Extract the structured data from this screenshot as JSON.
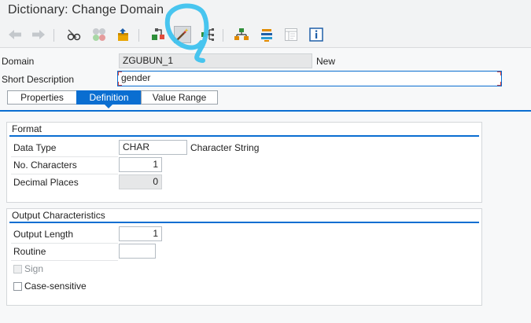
{
  "window": {
    "title": "Dictionary: Change Domain"
  },
  "toolbar": {
    "buttons": [
      {
        "icon": "back-arrow-icon"
      },
      {
        "icon": "forward-arrow-icon"
      },
      {
        "icon": "glasses-display-change-icon"
      },
      {
        "icon": "activate-icon"
      },
      {
        "icon": "transport-object-icon"
      },
      {
        "icon": "where-used-list-icon"
      },
      {
        "icon": "magic-wand-icon"
      },
      {
        "icon": "hierarchy-branch-icon"
      },
      {
        "icon": "object-hierarchy-icon"
      },
      {
        "icon": "stack-display-icon"
      },
      {
        "icon": "documentation-icon"
      },
      {
        "icon": "info-icon"
      }
    ]
  },
  "header": {
    "domain_label": "Domain",
    "domain_value": "ZGUBUN_1",
    "status": "New",
    "short_desc_label": "Short Description",
    "short_desc_value": "gender"
  },
  "tabs": [
    {
      "label": "Properties",
      "active": false
    },
    {
      "label": "Definition",
      "active": true
    },
    {
      "label": "Value Range",
      "active": false
    }
  ],
  "format": {
    "title": "Format",
    "data_type_label": "Data Type",
    "data_type_value": "CHAR",
    "data_type_desc": "Character String",
    "no_chars_label": "No. Characters",
    "no_chars_value": "1",
    "decimal_label": "Decimal Places",
    "decimal_value": "0"
  },
  "output": {
    "title": "Output Characteristics",
    "output_length_label": "Output Length",
    "output_length_value": "1",
    "routine_label": "Routine",
    "routine_value": "",
    "sign_label": "Sign",
    "sign_checked": false,
    "case_label": "Case-sensitive",
    "case_checked": false
  },
  "colors": {
    "accent": "#0a6ed1",
    "scribble": "#3ec2ee",
    "required_marker": "#d04343"
  }
}
